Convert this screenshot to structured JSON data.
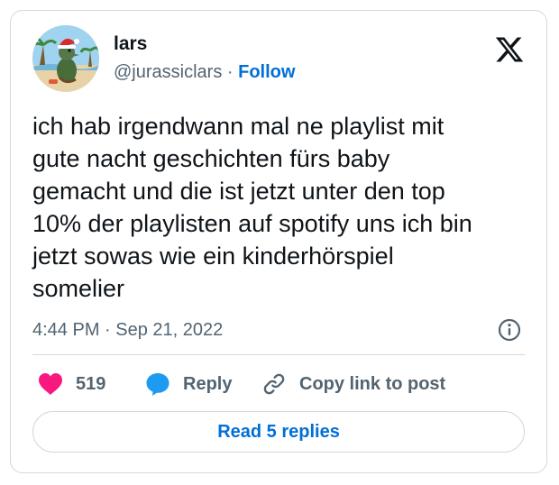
{
  "author": {
    "display_name": "lars",
    "handle": "@jurassiclars",
    "separator": "·",
    "follow_label": "Follow",
    "avatar_icon": "avatar-dinosaur-santa-hat-beach"
  },
  "platform_icon": "x-logo-icon",
  "tweet": {
    "text": "ich hab irgendwann mal ne playlist mit\ngute nacht geschichten fürs baby\ngemacht und die ist jetzt unter den top\n10% der playlisten auf spotify uns ich bin\njetzt sowas wie ein kinderhörspiel\nsomelier",
    "time": "4:44 PM",
    "date_separator": "·",
    "date": "Sep 21, 2022"
  },
  "actions": {
    "like_count": "519",
    "reply_label": "Reply",
    "copy_link_label": "Copy link to post"
  },
  "read_replies_label": "Read 5 replies",
  "colors": {
    "like_heart": "#f91880",
    "reply_bubble": "#1d9bf0",
    "link_blue": "#006fd6",
    "secondary_text": "#536471",
    "border": "#cfd9de"
  }
}
